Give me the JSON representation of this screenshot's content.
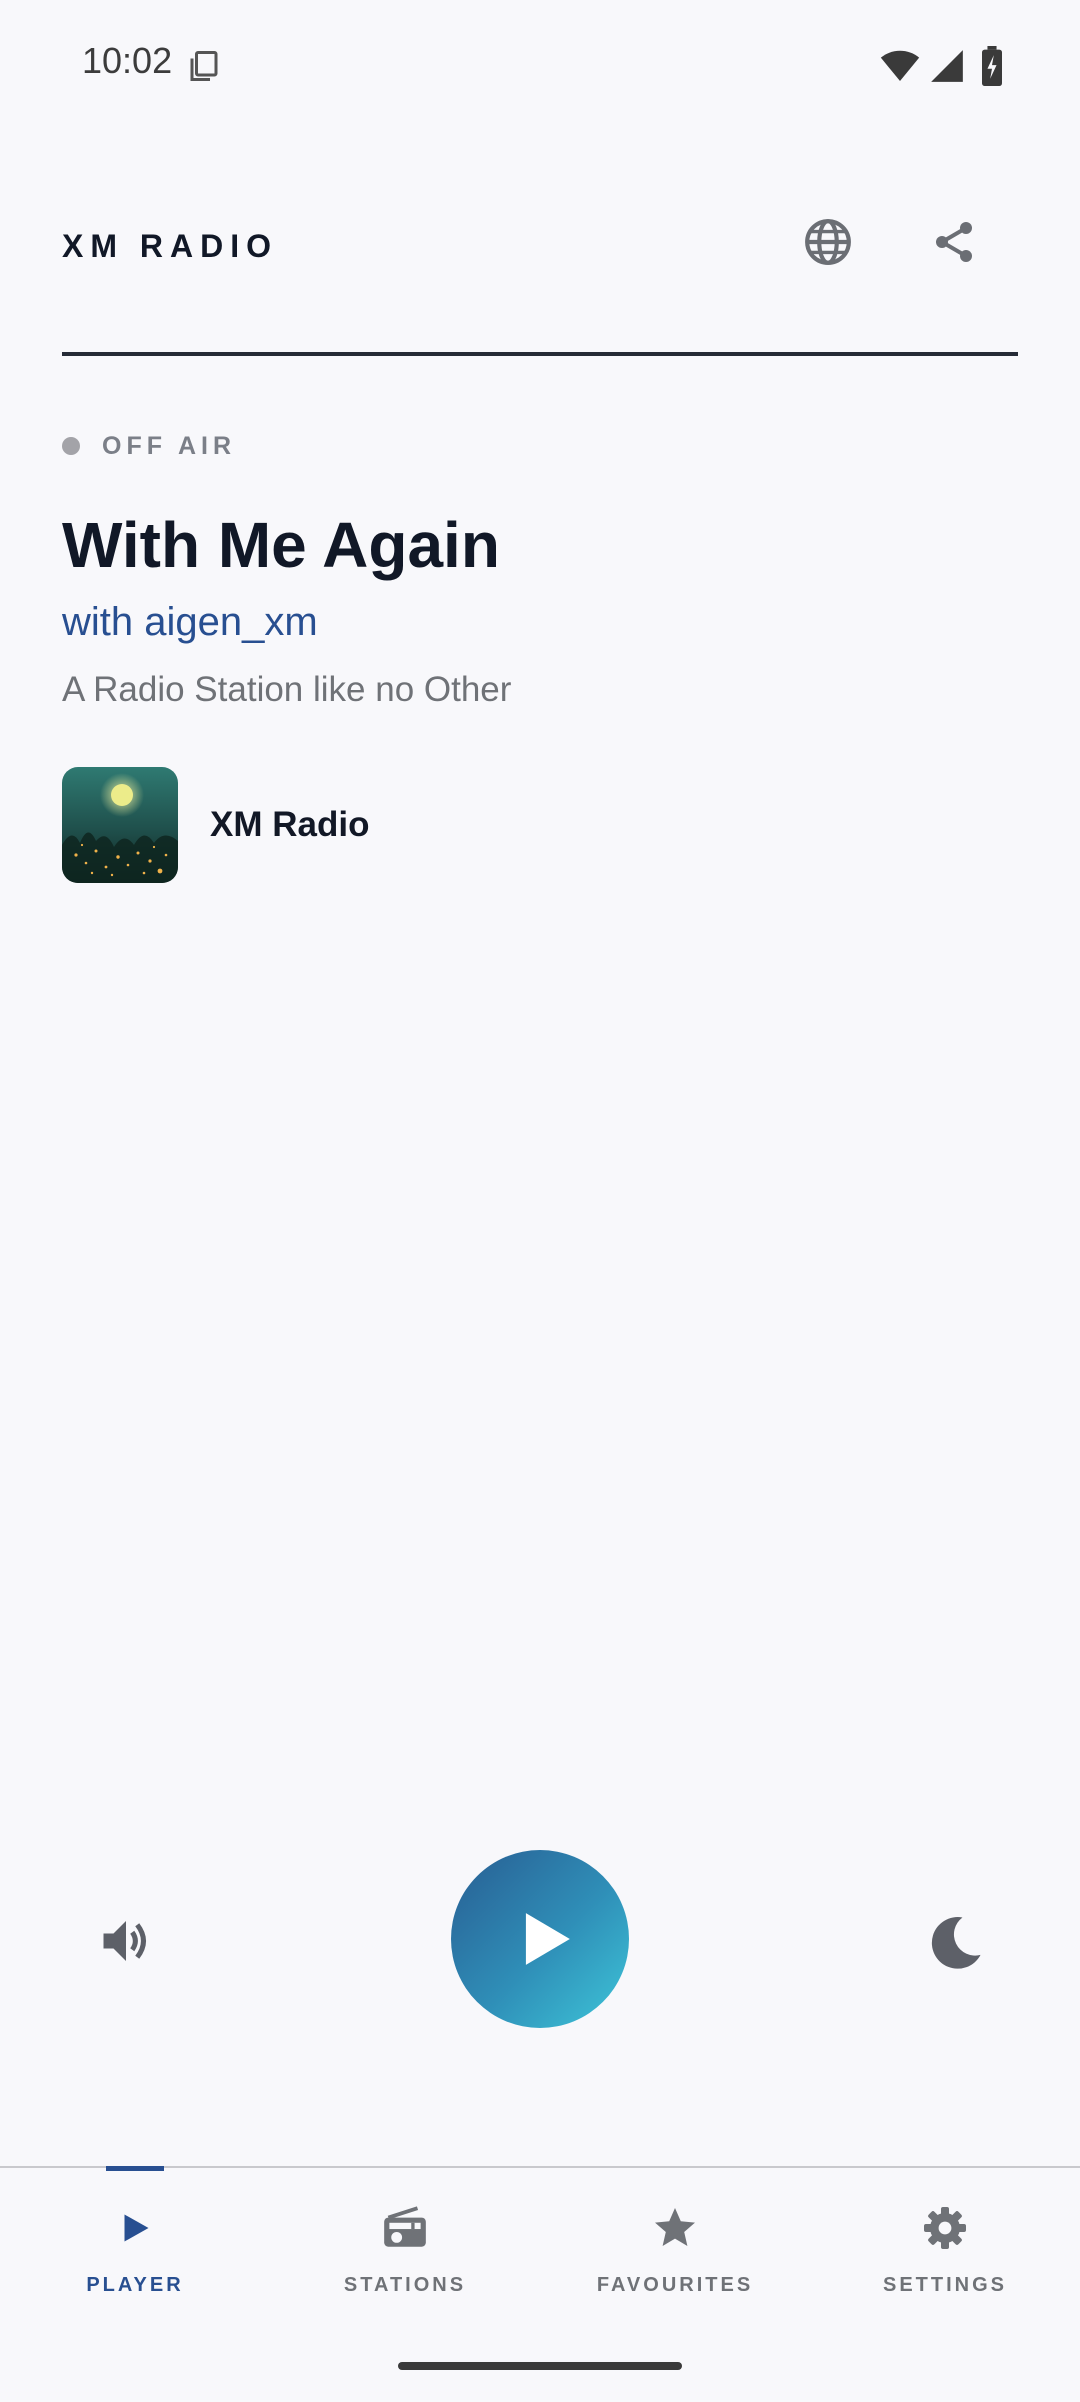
{
  "status_bar": {
    "time": "10:02",
    "icons": [
      "screenshot-icon",
      "wifi-icon",
      "signal-icon",
      "battery-charging-icon"
    ]
  },
  "header": {
    "title": "XM RADIO",
    "icons": [
      "globe-icon",
      "share-icon"
    ]
  },
  "broadcast": {
    "status": "OFF AIR",
    "status_color": "#a3a3a8",
    "title": "With Me Again",
    "host": "with aigen_xm",
    "description": "A Radio Station like no Other",
    "station_name": "XM Radio"
  },
  "controls": {
    "icons": [
      "volume-icon",
      "play-icon",
      "moon-icon"
    ],
    "play_gradient": [
      "#285d92",
      "#3ec6d9"
    ]
  },
  "bottom_nav": {
    "items": [
      {
        "label": "PLAYER",
        "icon": "play-icon",
        "active": true
      },
      {
        "label": "STATIONS",
        "icon": "radio-icon",
        "active": false
      },
      {
        "label": "FAVOURITES",
        "icon": "star-icon",
        "active": false
      },
      {
        "label": "SETTINGS",
        "icon": "gear-icon",
        "active": false
      }
    ]
  },
  "colors": {
    "accent": "#284f91",
    "background": "#f8f8fb",
    "text_primary": "#111827",
    "text_secondary": "#6f7277"
  }
}
